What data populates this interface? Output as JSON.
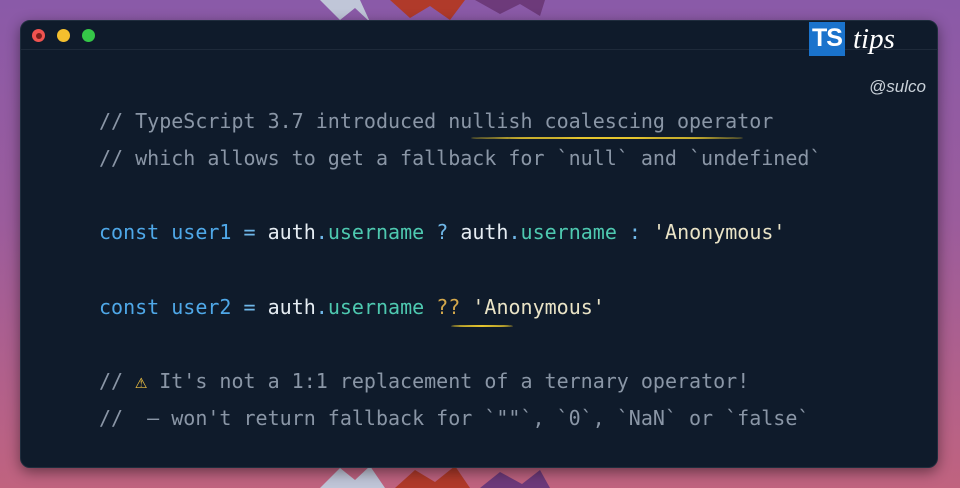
{
  "window": {
    "controls": [
      "close",
      "minimize",
      "maximize"
    ]
  },
  "brand": {
    "badge": "TS",
    "tips": "tips",
    "handle": "@sulco"
  },
  "code": {
    "comment1_a": "// TypeScript 3.7 introduced ",
    "comment1_b": "nullish coalescing",
    "comment1_c": " operator",
    "comment2": "// which allows to get a fallback for `null` and `undefined`",
    "l1_const": "const",
    "l1_var": "user1",
    "l1_eq": "=",
    "l1_auth1": "auth",
    "l1_dot1": ".",
    "l1_prop1": "username",
    "l1_q": "?",
    "l1_auth2": "auth",
    "l1_dot2": ".",
    "l1_prop2": "username",
    "l1_colon": ":",
    "l1_str": "'Anonymous'",
    "l2_const": "const",
    "l2_var": "user2",
    "l2_eq": "=",
    "l2_auth": "auth",
    "l2_dot": ".",
    "l2_prop": "username",
    "l2_op": "??",
    "l2_str": "'Anonymous'",
    "warn_prefix": "//",
    "warn_icon": "⚠",
    "warn_text": " It's not a 1:1 replacement of a ternary operator!",
    "last_line": "//  – won't return fallback for `\"\"`, `0`, `NaN` or `false`"
  },
  "colors": {
    "background": "#0f1b2b",
    "keyword": "#4fa8e8",
    "property": "#4ec9b0",
    "comment": "#8a96a6",
    "underline": "#e5c52e"
  }
}
